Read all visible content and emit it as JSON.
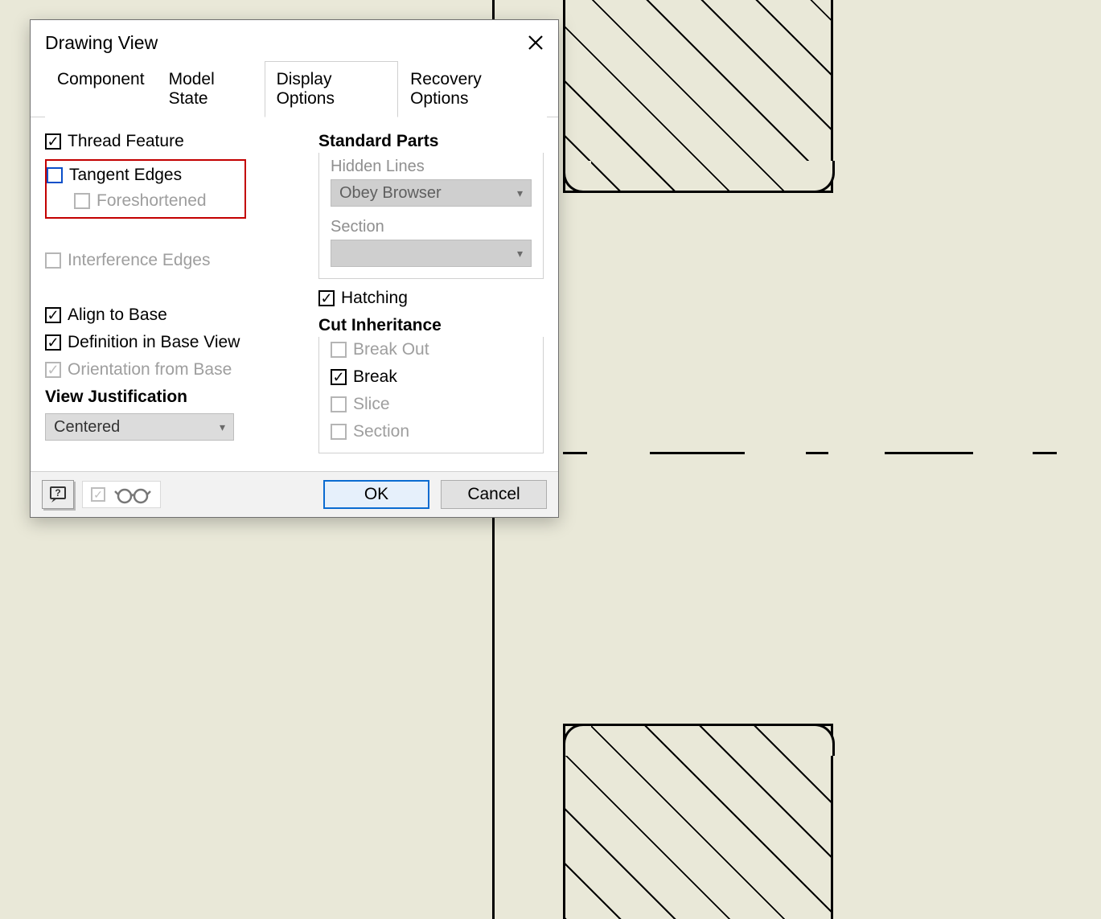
{
  "dialog": {
    "title": "Drawing View"
  },
  "tabs": {
    "component": "Component",
    "modelState": "Model State",
    "displayOptions": "Display Options",
    "recoveryOptions": "Recovery Options"
  },
  "left": {
    "threadFeature": "Thread Feature",
    "tangentEdges": "Tangent Edges",
    "foreshortened": "Foreshortened",
    "interferenceEdges": "Interference Edges",
    "alignToBase": "Align to Base",
    "definitionInBaseView": "Definition in Base View",
    "orientationFromBase": "Orientation from Base",
    "viewJustificationLabel": "View Justification",
    "viewJustificationValue": "Centered"
  },
  "right": {
    "standardPartsHeader": "Standard Parts",
    "hiddenLinesLabel": "Hidden Lines",
    "hiddenLinesValue": "Obey Browser",
    "sectionLabel": "Section",
    "sectionValue": "",
    "hatching": "Hatching",
    "cutInheritanceHeader": "Cut Inheritance",
    "breakOut": "Break Out",
    "break": "Break",
    "slice": "Slice",
    "section": "Section"
  },
  "footer": {
    "ok": "OK",
    "cancel": "Cancel"
  }
}
